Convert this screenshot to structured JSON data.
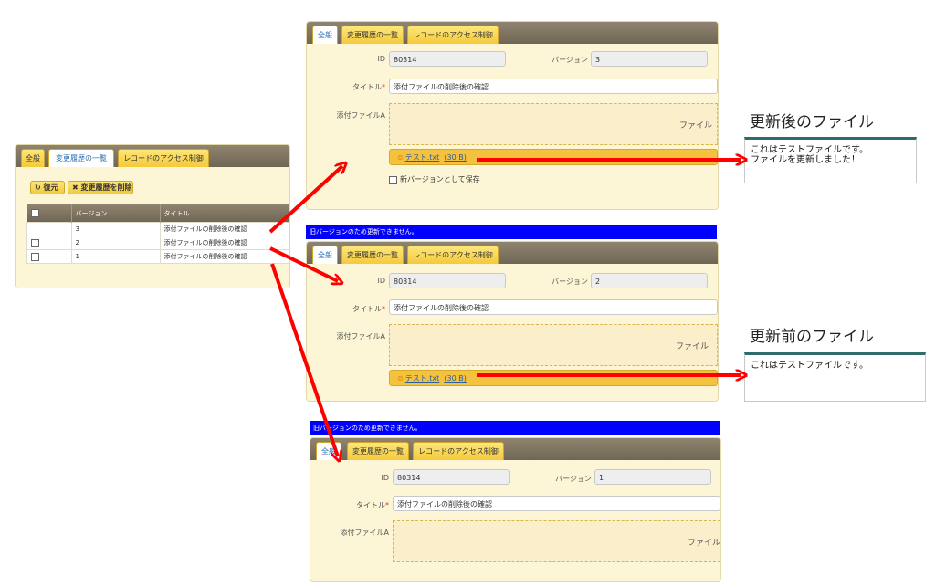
{
  "tabs": {
    "general": "全般",
    "history": "変更履歴の一覧",
    "access": "レコードのアクセス制御"
  },
  "labels": {
    "id": "ID",
    "version": "バージョン",
    "title": "タイトル",
    "required": "*",
    "attachment": "添付ファイルA",
    "file_word": "ファイル"
  },
  "history_panel": {
    "restore_button": "復元",
    "delete_button": "変更履歴を削除",
    "columns": [
      "",
      "バージョン",
      "タイトル"
    ],
    "rows": [
      {
        "version": "3",
        "title": "添付ファイルの削除後の確認"
      },
      {
        "version": "2",
        "title": "添付ファイルの削除後の確認"
      },
      {
        "version": "1",
        "title": "添付ファイルの削除後の確認"
      }
    ]
  },
  "panel_v3": {
    "id": "80314",
    "version": "3",
    "title": "添付ファイルの削除後の確認",
    "file": "テスト.txt",
    "file_size": "(30 B)",
    "new_version_label": "新バージョンとして保存"
  },
  "panel_v2": {
    "banner": "旧バージョンのため更新できません。",
    "id": "80314",
    "version": "2",
    "title": "添付ファイルの削除後の確認",
    "file": "テスト.txt",
    "file_size": "(30 B)"
  },
  "panel_v1": {
    "banner": "旧バージョンのため更新できません。",
    "id": "80314",
    "version": "1",
    "title": "添付ファイルの削除後の確認"
  },
  "notes": {
    "after_title": "更新後のファイル",
    "after_line1": "これはテストファイルです。",
    "after_line2": "ファイルを更新しました！",
    "before_title": "更新前のファイル",
    "before_line1": "これはテストファイルです。"
  },
  "colors": {
    "arrow": "#ff0000",
    "banner": "#0000ff",
    "tab": "#f5c93a",
    "panel": "#fdf6d6",
    "header": "#7a715e"
  },
  "icons": {
    "restore": "restore-icon",
    "delete": "x-icon",
    "file": "file-icon"
  }
}
